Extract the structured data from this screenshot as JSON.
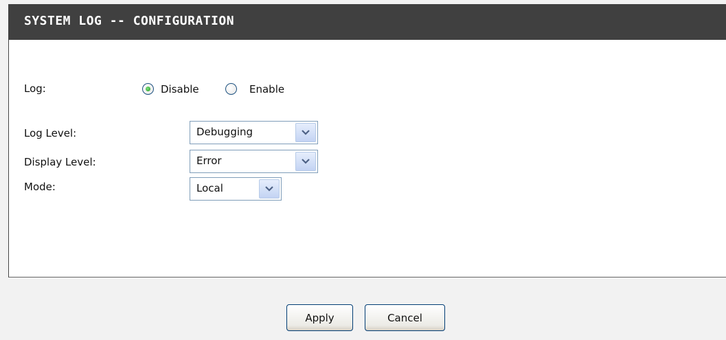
{
  "panel": {
    "title": "SYSTEM LOG -- CONFIGURATION"
  },
  "log": {
    "label": "Log:",
    "options": [
      {
        "label": "Disable",
        "selected": true
      },
      {
        "label": "Enable",
        "selected": false
      }
    ]
  },
  "log_level": {
    "label": "Log Level:",
    "value": "Debugging"
  },
  "display_level": {
    "label": "Display Level:",
    "value": "Error"
  },
  "mode": {
    "label": "Mode:",
    "value": "Local"
  },
  "buttons": {
    "apply": "Apply",
    "cancel": "Cancel"
  },
  "colors": {
    "header_bg": "#404040",
    "radio_selected": "#1f9a1f",
    "select_border": "#7f9db9",
    "button_border": "#003c74"
  }
}
